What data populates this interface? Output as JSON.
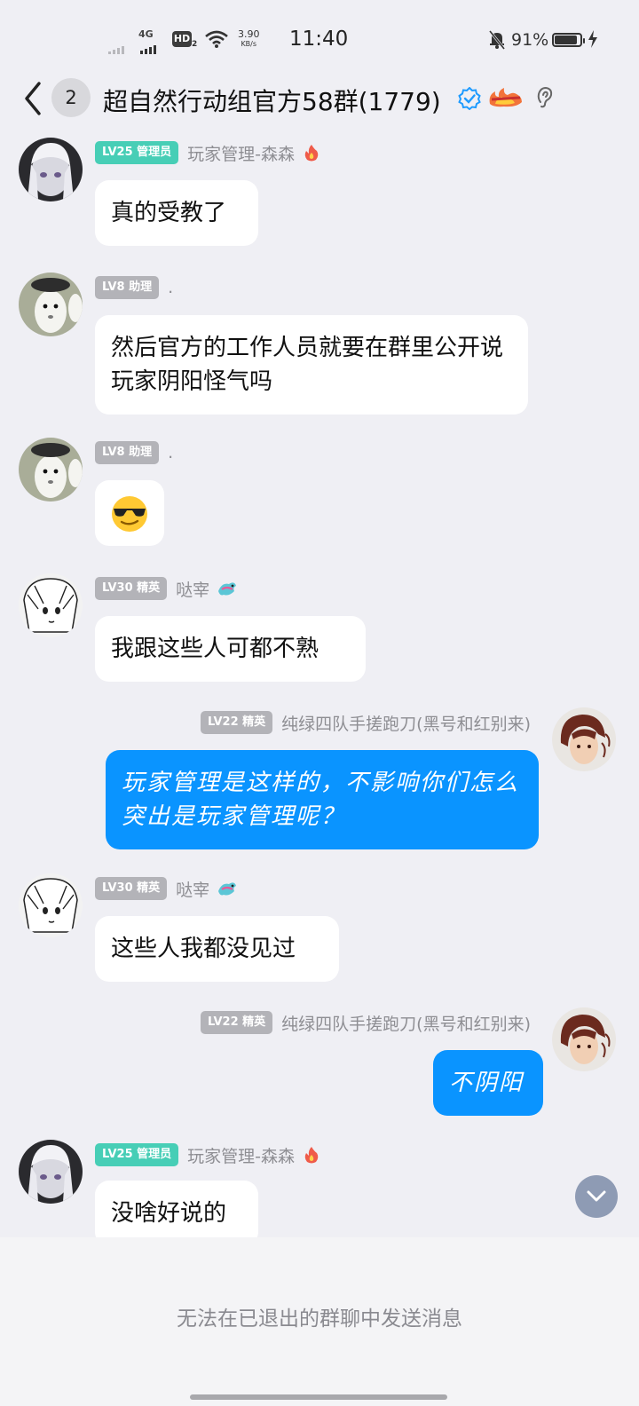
{
  "status_bar": {
    "network": "4G",
    "hd_label": "HD",
    "hd_sub": "2",
    "speed_value": "3.90",
    "speed_unit": "KB/s",
    "time": "11:40",
    "battery_text": "91%",
    "battery_level": 0.91
  },
  "header": {
    "unread_count": "2",
    "title": "超自然行动组官方58群(1779)"
  },
  "messages": [
    {
      "level": "LV25 管理员",
      "sender": "玩家管理-森森",
      "text": "真的受教了"
    },
    {
      "level": "LV8 助理",
      "sender": ".",
      "text": "然后官方的工作人员就要在群里公开说玩家阴阳怪气吗"
    },
    {
      "level": "LV8 助理",
      "sender": ".",
      "text": "😎"
    },
    {
      "level": "LV30 精英",
      "sender": "哒宰",
      "text": "我跟这些人可都不熟"
    },
    {
      "level": "LV22 精英",
      "sender": "纯绿四队手搓跑刀(黑号和红别来)",
      "text": "玩家管理是这样的，不影响你们怎么突出是玩家管理呢？"
    },
    {
      "level": "LV30 精英",
      "sender": "哒宰",
      "text": "这些人我都没见过"
    },
    {
      "level": "LV22 精英",
      "sender": "纯绿四队手搓跑刀(黑号和红别来)",
      "text": "不阴阳"
    },
    {
      "level": "LV25 管理员",
      "sender": "玩家管理-森森",
      "text": "没啥好说的"
    }
  ],
  "footer": {
    "notice": "无法在已退出的群聊中发送消息"
  },
  "colors": {
    "accent": "#0a94ff",
    "admin_badge": "#47ceb6",
    "level_badge": "#b3b3b8",
    "background": "#efeff4"
  }
}
